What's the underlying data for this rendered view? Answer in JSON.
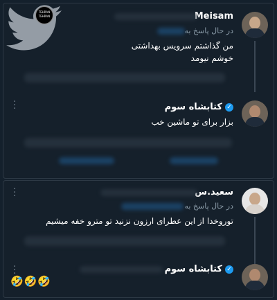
{
  "watermark": {
    "badge_top": "TEHRAN",
    "badge_bottom": "TEHRAN"
  },
  "post1": {
    "author": "Meisam",
    "reply_label": "در حال پاسخ به",
    "line1": "من گذاشتم سرویس بهداشتی",
    "line2": "خوشم نیومد"
  },
  "post2": {
    "author": "کتابشاه سوم",
    "text": "بزار برای تو ماشین خب"
  },
  "post3": {
    "author": "سعید.س",
    "reply_label": "در حال پاسخ به",
    "text": "توروخدا از این عطرای ارزون نزنید تو مترو خفه میشیم"
  },
  "post4": {
    "author": "کتابشاه سوم",
    "emojis": "🤣🤣🤣"
  },
  "colors": {
    "background": "#15202b",
    "verified": "#1d9bf0",
    "muted": "#8899a6"
  }
}
